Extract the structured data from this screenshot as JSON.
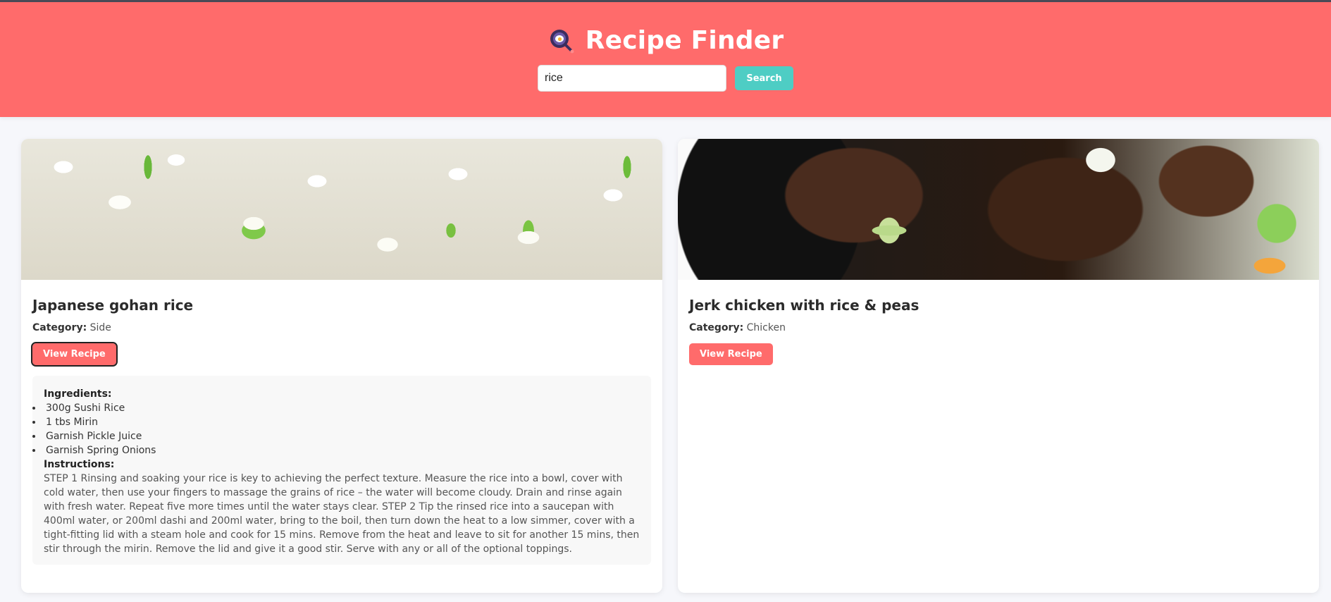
{
  "header": {
    "title": "Recipe Finder",
    "logo_icon": "magnifier-egg-icon",
    "search": {
      "value": "rice",
      "button_label": "Search"
    },
    "accent_color": "#ff6b6b",
    "button_color": "#4ecdc4"
  },
  "recipes": [
    {
      "title": "Japanese gohan rice",
      "category_label": "Category:",
      "category": "Side",
      "button_label": "View Recipe",
      "image": "rice-photo",
      "ingredients_label": "Ingredients:",
      "ingredients": [
        "300g Sushi Rice",
        "1 tbs Mirin",
        "Garnish Pickle Juice",
        "Garnish Spring Onions"
      ],
      "instructions_label": "Instructions:",
      "instructions": "STEP 1 Rinsing and soaking your rice is key to achieving the perfect texture. Measure the rice into a bowl, cover with cold water, then use your fingers to massage the grains of rice – the water will become cloudy. Drain and rinse again with fresh water. Repeat five more times until the water stays clear. STEP 2 Tip the rinsed rice into a saucepan with 400ml water, or 200ml dashi and 200ml water, bring to the boil, then turn down the heat to a low simmer, cover with a tight-fitting lid with a steam hole and cook for 15 mins. Remove from the heat and leave to sit for another 15 mins, then stir through the mirin. Remove the lid and give it a good stir. Serve with any or all of the optional toppings."
    },
    {
      "title": "Jerk chicken with rice & peas",
      "category_label": "Category:",
      "category": "Chicken",
      "button_label": "View Recipe",
      "image": "jerk-chicken-photo"
    }
  ]
}
